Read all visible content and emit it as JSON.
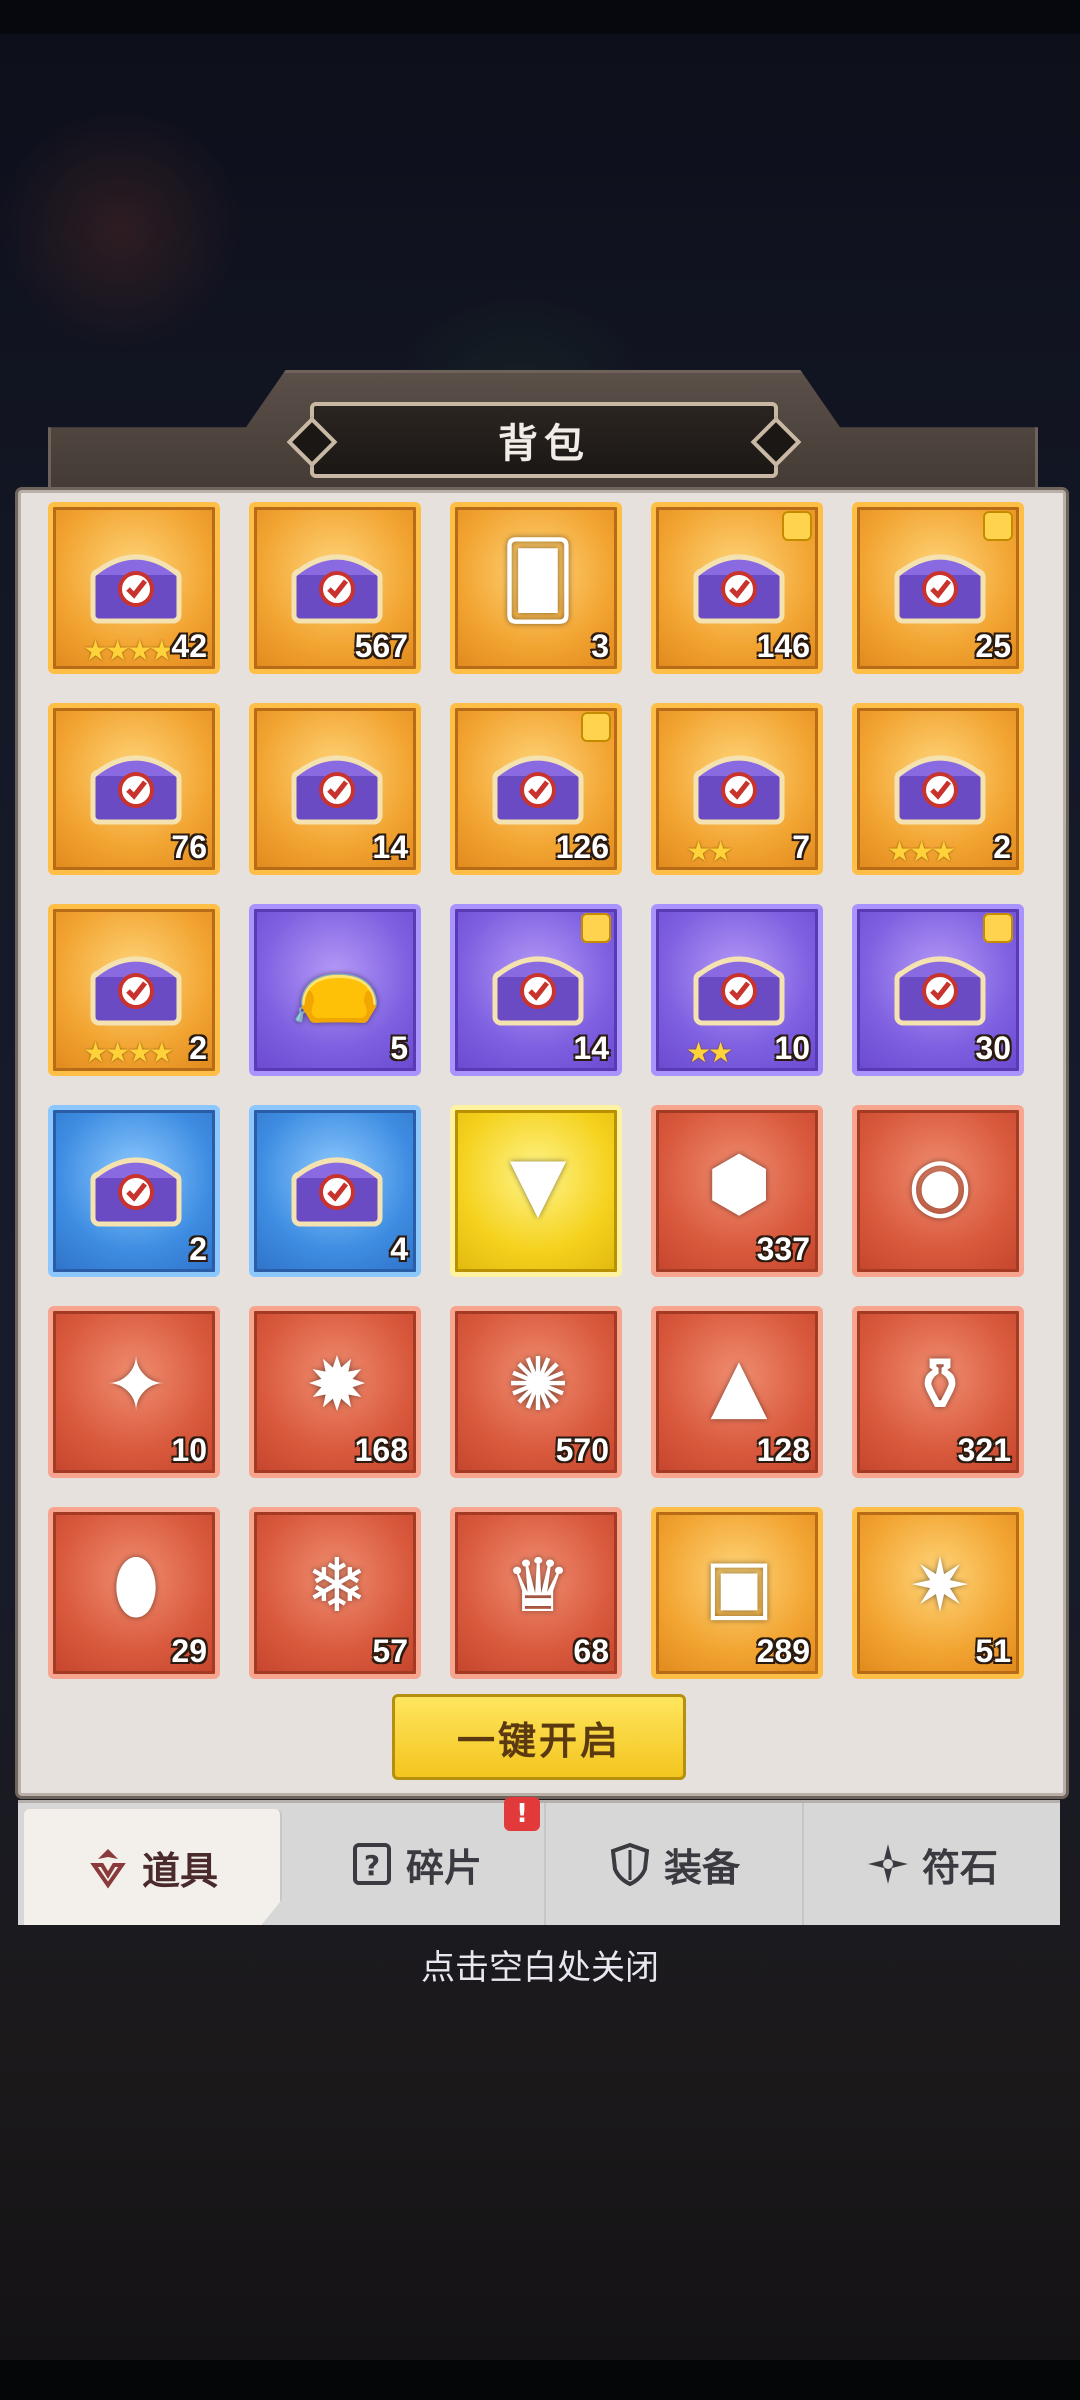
{
  "panel": {
    "title": "背包",
    "close_hint": "点击空白处关闭",
    "open_all_label": "一键开启"
  },
  "tabs": [
    {
      "label": "道具",
      "icon": "item-bag-icon",
      "active": true
    },
    {
      "label": "碎片",
      "icon": "fragment-question-icon",
      "badge": "!"
    },
    {
      "label": "装备",
      "icon": "shield-icon"
    },
    {
      "label": "符石",
      "icon": "rune-star-icon"
    }
  ],
  "items": [
    {
      "icon": "mystery-gear-chest-icon",
      "rarity": "orange",
      "count": "42",
      "stars": "★★★★"
    },
    {
      "icon": "blue-treasure-chest-icon",
      "rarity": "orange",
      "count": "567"
    },
    {
      "icon": "hero-card-icon",
      "rarity": "orange",
      "count": "3"
    },
    {
      "icon": "silver-chest-icon",
      "rarity": "orange",
      "count": "146",
      "puzzle": true
    },
    {
      "icon": "wooden-chest-icon",
      "rarity": "orange",
      "count": "25",
      "puzzle": true
    },
    {
      "icon": "gem-select-chest-icon",
      "rarity": "orange",
      "count": "76"
    },
    {
      "icon": "crystal-select-chest-icon",
      "rarity": "orange",
      "count": "14"
    },
    {
      "icon": "card-select-chest-icon",
      "rarity": "orange",
      "count": "126",
      "puzzle": true
    },
    {
      "icon": "gear-select-chest-icon",
      "rarity": "orange",
      "count": "7",
      "stars": "★★"
    },
    {
      "icon": "gear-select-chest-icon",
      "rarity": "orange",
      "count": "2",
      "stars": "★★★"
    },
    {
      "icon": "gear-select-chest-icon",
      "rarity": "orange",
      "count": "2",
      "stars": "★★★★"
    },
    {
      "icon": "red-pouch-icon",
      "rarity": "purple",
      "count": "5"
    },
    {
      "icon": "mystery-purple-chest-icon",
      "rarity": "purple",
      "count": "14",
      "puzzle": true
    },
    {
      "icon": "mystery-gear-chest-icon",
      "rarity": "purple",
      "count": "10",
      "stars": "★★"
    },
    {
      "icon": "select-purple-chest-icon",
      "rarity": "purple",
      "count": "30",
      "puzzle": true
    },
    {
      "icon": "mystery-pet-chest-icon",
      "rarity": "blue",
      "count": "2"
    },
    {
      "icon": "select-pet-chest-icon",
      "rarity": "blue",
      "count": "4"
    },
    {
      "icon": "vine-gem-icon",
      "rarity": "gold",
      "count": ""
    },
    {
      "icon": "ice-cube-icon",
      "rarity": "red",
      "count": "337"
    },
    {
      "icon": "sealed-orb-icon",
      "rarity": "red",
      "count": ""
    },
    {
      "icon": "prism-crystal-icon",
      "rarity": "red",
      "count": "10"
    },
    {
      "icon": "red-emblem-icon",
      "rarity": "red",
      "count": "168"
    },
    {
      "icon": "green-emblem-icon",
      "rarity": "red",
      "count": "570"
    },
    {
      "icon": "crystal-dust-icon",
      "rarity": "red",
      "count": "128"
    },
    {
      "icon": "purple-potion-icon",
      "rarity": "red",
      "count": "321"
    },
    {
      "icon": "golden-egg-icon",
      "rarity": "red",
      "count": "29"
    },
    {
      "icon": "ice-flower-icon",
      "rarity": "red",
      "count": "57"
    },
    {
      "icon": "ruby-crown-icon",
      "rarity": "red",
      "count": "68"
    },
    {
      "icon": "gold-book-icon",
      "rarity": "orange",
      "count": "289"
    },
    {
      "icon": "golden-star-icon",
      "rarity": "orange",
      "count": "51"
    }
  ]
}
